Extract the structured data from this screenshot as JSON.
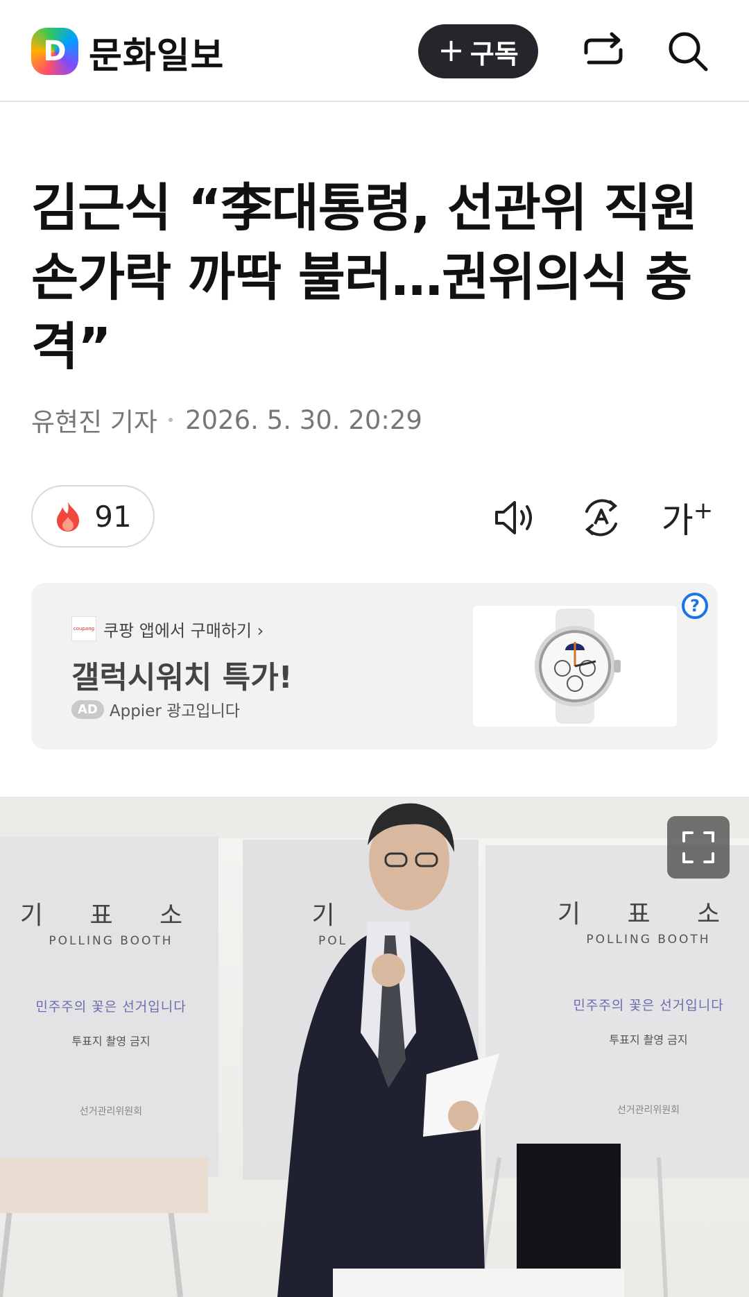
{
  "header": {
    "logo_letter": "D",
    "brand_name": "문화일보",
    "subscribe_plus": "+",
    "subscribe_label": "구독"
  },
  "article": {
    "headline_lines": [
      "김근식 “李대통령, 선관위 직원",
      "손가락 까딱 불러…권위의식 충",
      "격”"
    ],
    "reporter": "유현진 기자",
    "datetime": "2026. 5. 30. 20:29"
  },
  "reactions": {
    "count": "91",
    "font_tool_label": "가",
    "font_tool_plus": "+"
  },
  "ad": {
    "source_logo": "coupang",
    "source_text": "쿠팡 앱에서 구매하기 ›",
    "title": "갤럭시워치 특가!",
    "tag": "AD",
    "advertiser": "Appier 광고입니다",
    "help_glyph": "?"
  },
  "photo": {
    "booths": [
      {
        "title": "기 표 소",
        "sub": "POLLING BOOTH",
        "slogan": "민주주의 꽃은 선거입니다",
        "warn": "투표지 촬영 금지",
        "org": "선거관리위원회"
      },
      {
        "title": "기",
        "sub": "POL",
        "slogan": "",
        "warn": "",
        "org": ""
      },
      {
        "title": "기 표 소",
        "sub": "POLLING BOOTH",
        "slogan": "민주주의 꽃은 선거입니다",
        "warn": "투표지 촬영 금지",
        "org": "선거관리위원회"
      }
    ]
  },
  "icons": {
    "share": "share-icon",
    "search": "search-icon",
    "fire": "fire-icon",
    "audio": "speaker-icon",
    "translate": "translate-icon",
    "expand": "expand-icon"
  },
  "colors": {
    "subscribe_bg": "#24262b",
    "ad_bg": "#f2f2f2",
    "help_blue": "#1a73e8",
    "fire": "#f0483e"
  }
}
